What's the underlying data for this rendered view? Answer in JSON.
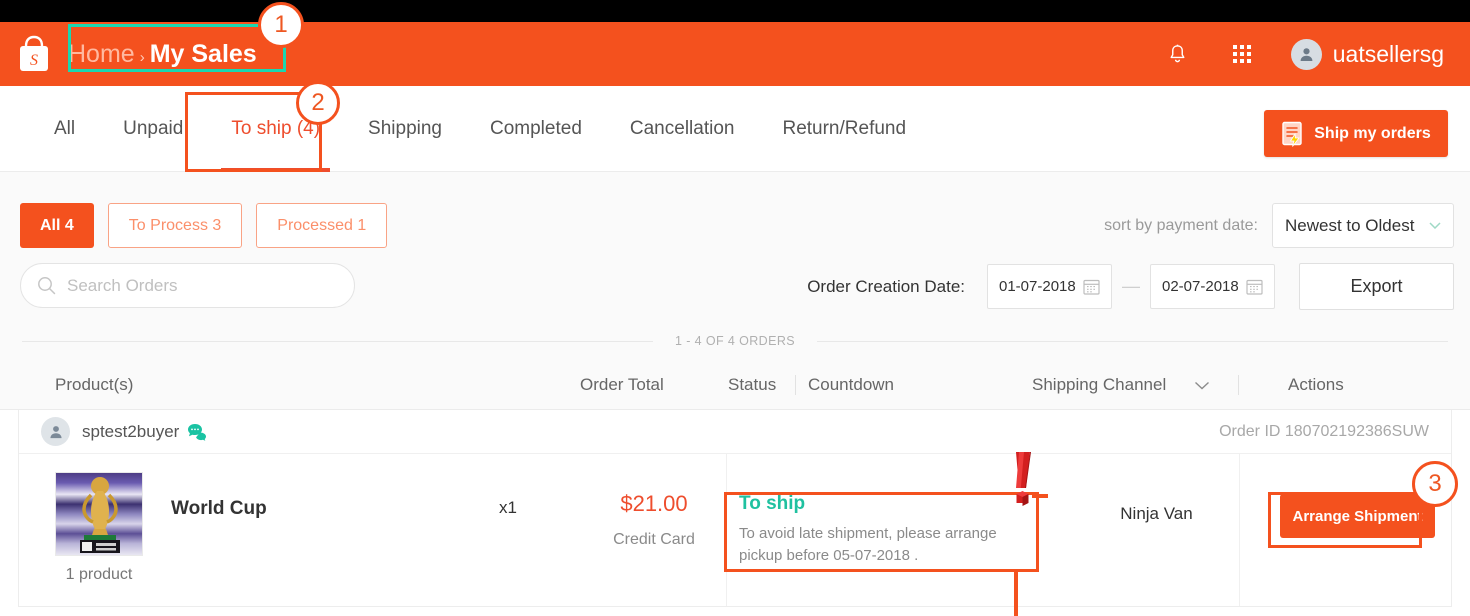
{
  "header": {
    "logo": "shopee-bag-logo",
    "breadcrumb": {
      "home": "Home",
      "separator": "›",
      "current": "My Sales"
    },
    "bell_icon": "bell-icon",
    "apps_icon": "apps-grid-icon",
    "user": "uatsellersg"
  },
  "tabs": [
    {
      "label": "All",
      "active": false
    },
    {
      "label": "Unpaid",
      "active": false
    },
    {
      "label": "To ship (4)",
      "active": true
    },
    {
      "label": "Shipping",
      "active": false
    },
    {
      "label": "Completed",
      "active": false
    },
    {
      "label": "Cancellation",
      "active": false
    },
    {
      "label": "Return/Refund",
      "active": false
    }
  ],
  "ship_button": {
    "label": "Ship my orders",
    "icon": "document-lightning-icon"
  },
  "filters": {
    "chips": [
      {
        "label": "All 4",
        "selected": true
      },
      {
        "label": "To Process 3",
        "selected": false
      },
      {
        "label": "Processed 1",
        "selected": false
      }
    ],
    "sort_label": "sort by payment date:",
    "sort_value": "Newest to Oldest",
    "search_placeholder": "Search Orders",
    "search_value": "",
    "search_icon": "search-icon",
    "date_label": "Order Creation Date:",
    "date_from": "01-07-2018",
    "date_to": "02-07-2018",
    "date_separator": "—",
    "calendar_icon": "calendar-icon",
    "export_label": "Export"
  },
  "table": {
    "count_text": "1 - 4 OF 4 ORDERS",
    "columns": {
      "products": "Product(s)",
      "order_total": "Order Total",
      "status": "Status",
      "countdown": "Countdown",
      "shipping_channel": "Shipping Channel",
      "actions": "Actions"
    }
  },
  "order": {
    "buyer": "sptest2buyer",
    "chat_icon": "chat-bubble-icon",
    "order_id": "Order ID 180702192386SUW",
    "product_name": "World Cup",
    "product_count": "1 product",
    "product_image": "world-cup-trophy",
    "quantity": "x1",
    "price": "$21.00",
    "payment_method": "Credit Card",
    "status": "To ship",
    "status_note": "To avoid late shipment, please arrange pickup before 05-07-2018 .",
    "shipping_channel": "Ninja Van",
    "action_label": "Arrange Shipment"
  },
  "annotations": {
    "badge1": "1",
    "badge2": "2",
    "badge3": "3",
    "warning_icon": "red-exclamation-mark",
    "colors": {
      "orange": "#f4511e",
      "teal": "#1ad7b0",
      "accent": "#ee4d2d",
      "status_green": "#1fc1a0"
    }
  }
}
